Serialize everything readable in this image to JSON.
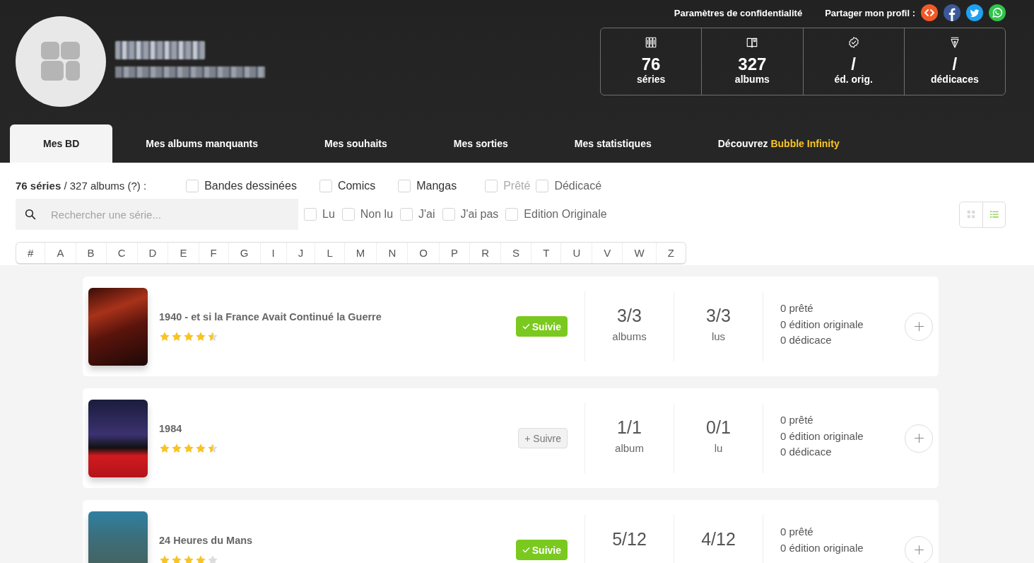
{
  "header": {
    "privacy_link": "Paramètres de confidentialité",
    "share_label": "Partager mon profil :",
    "share_buttons": [
      {
        "kind": "embed"
      },
      {
        "kind": "facebook"
      },
      {
        "kind": "twitter"
      },
      {
        "kind": "whatsapp"
      }
    ],
    "stats": [
      {
        "kind": "series",
        "value": "76",
        "label": "séries"
      },
      {
        "kind": "albums",
        "value": "327",
        "label": "albums"
      },
      {
        "kind": "original",
        "value": "/",
        "label": "éd. orig."
      },
      {
        "kind": "dedication",
        "value": "/",
        "label": "dédicaces"
      }
    ]
  },
  "tabs": [
    {
      "label": "Mes BD",
      "selected": true
    },
    {
      "label": "Mes albums manquants",
      "selected": false
    },
    {
      "label": "Mes souhaits",
      "selected": false
    },
    {
      "label": "Mes sorties",
      "selected": false
    },
    {
      "label": "Mes statistiques",
      "selected": false
    },
    {
      "label": "Découvrez",
      "highlight": "Bubble Infinity",
      "selected": false
    }
  ],
  "summary": "**76 séries** / 327 albums (?) :",
  "search": {
    "placeholder": "Rechercher une série..."
  },
  "filter_rows": [
    {
      "items": [
        {
          "label": "Bandes dessinées",
          "kind": "type",
          "checked": false,
          "disabled": false
        },
        {
          "label": "Comics",
          "kind": "type",
          "checked": false,
          "disabled": false
        },
        {
          "label": "Mangas",
          "kind": "type",
          "checked": false,
          "disabled": false
        },
        {
          "label": "Prêté",
          "kind": "status",
          "checked": false,
          "disabled": true
        },
        {
          "label": "Dédicacé",
          "kind": "status",
          "checked": false,
          "disabled": false
        }
      ]
    },
    {
      "items": [
        {
          "label": "Lu",
          "kind": "status",
          "checked": false,
          "disabled": false
        },
        {
          "label": "Non lu",
          "kind": "status",
          "checked": false,
          "disabled": false
        },
        {
          "label": "J'ai",
          "kind": "status",
          "checked": false,
          "disabled": false
        },
        {
          "label": "J'ai pas",
          "kind": "status",
          "checked": false,
          "disabled": false
        },
        {
          "label": "Edition Originale",
          "kind": "status",
          "checked": false,
          "disabled": false
        }
      ]
    }
  ],
  "view_modes": [
    {
      "kind": "grid",
      "selected": false
    },
    {
      "kind": "list",
      "selected": true
    }
  ],
  "letters": [
    "#",
    "A",
    "B",
    "C",
    "D",
    "E",
    "F",
    "G",
    "I",
    "J",
    "L",
    "M",
    "N",
    "O",
    "P",
    "R",
    "S",
    "T",
    "U",
    "V",
    "W",
    "Z"
  ],
  "series": [
    {
      "title": "1940 - et si la France Avait Continué la Guerre",
      "stars": 4.5,
      "followed": true,
      "follow_label": "Suivie",
      "albums": {
        "value": "3/3",
        "label": "albums"
      },
      "read": {
        "value": "3/3",
        "label": "lus"
      },
      "details": [
        "0 prêté",
        "0 édition originale",
        "0 dédicace"
      ]
    },
    {
      "title": "1984",
      "stars": 4.5,
      "followed": false,
      "follow_label": "+ Suivre",
      "albums": {
        "value": "1/1",
        "label": "album"
      },
      "read": {
        "value": "0/1",
        "label": "lu"
      },
      "details": [
        "0 prêté",
        "0 édition originale",
        "0 dédicace"
      ]
    },
    {
      "title": "24 Heures du Mans",
      "stars": 4,
      "followed": true,
      "follow_label": "Suivie",
      "albums": {
        "value": "5/12"
      },
      "read": {
        "value": "4/12"
      },
      "details": [
        "0 prêté",
        "0 édition originale"
      ]
    }
  ]
}
